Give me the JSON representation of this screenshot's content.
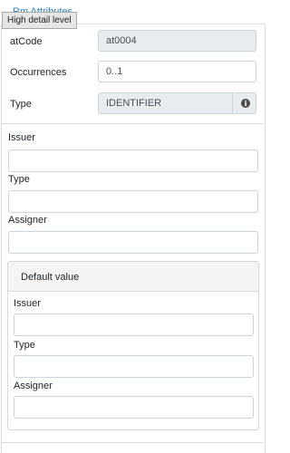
{
  "header": {
    "link_label": "Rm Attributes",
    "tooltip": "High detail level"
  },
  "fields": {
    "atcode_label": "atCode",
    "atcode_value": "at0004",
    "occurrences_label": "Occurrences",
    "occurrences_value": "0..1",
    "type_label": "Type",
    "type_value": "IDENTIFIER",
    "info_icon_glyph": "i"
  },
  "identifier": {
    "issuer_label": "Issuer",
    "type_label": "Type",
    "assigner_label": "Assigner"
  },
  "default_value": {
    "title": "Default value",
    "issuer_label": "Issuer",
    "type_label": "Type",
    "assigner_label": "Assigner"
  }
}
